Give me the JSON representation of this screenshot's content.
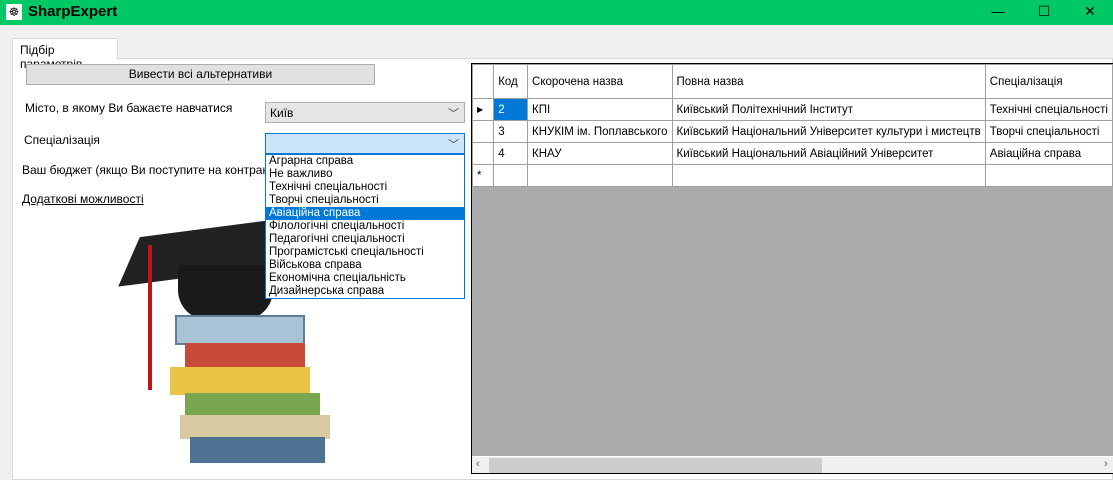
{
  "window": {
    "title": "SharpExpert",
    "icon": "app-logo-icon",
    "controls": [
      "minimize-icon",
      "maximize-icon",
      "close-icon"
    ]
  },
  "tab": {
    "label": "Підбір параметрів"
  },
  "form": {
    "show_all_button": "Вивести всі альтернативи",
    "city_label": "Місто, в якому Ви бажаєте навчатися",
    "city_value": "Київ",
    "spec_label": "Спеціалізація",
    "spec_value": "",
    "budget_label": "Ваш бюджет (якщо Ви поступите на контракт)",
    "extra_link": "Додаткові можливості",
    "spec_options": [
      "Аграрна справа",
      "Не важливо",
      "Технічні спеціальності",
      "Творчі спеціальності",
      "Авіаційна справа",
      "Філологічні спеціальності",
      "Педагогічні спеціальності",
      "Програмістські спеціальності",
      "Військова справа",
      "Економічна спеціальність",
      "Дизайнерська справа"
    ],
    "spec_highlighted": "Авіаційна справа"
  },
  "grid": {
    "columns": [
      "Код",
      "Скорочена назва",
      "Повна назва",
      "Спеціалізація"
    ],
    "rows": [
      [
        "2",
        "КПІ",
        "Київський Політехнічний Інститут",
        "Технічні спеціальності"
      ],
      [
        "3",
        "КНУКІМ ім. Поплавського",
        "Київський Національний Університет культури і мистецтв",
        "Творчі спеціальності"
      ],
      [
        "4",
        "КНАУ",
        "Київський Національний Авіаційний Університет",
        "Авіаційна справа"
      ]
    ],
    "current_row_marker": "▶",
    "new_row_marker": "*"
  },
  "colors": {
    "titlebar": "#00c864",
    "selection": "#0078d7"
  }
}
